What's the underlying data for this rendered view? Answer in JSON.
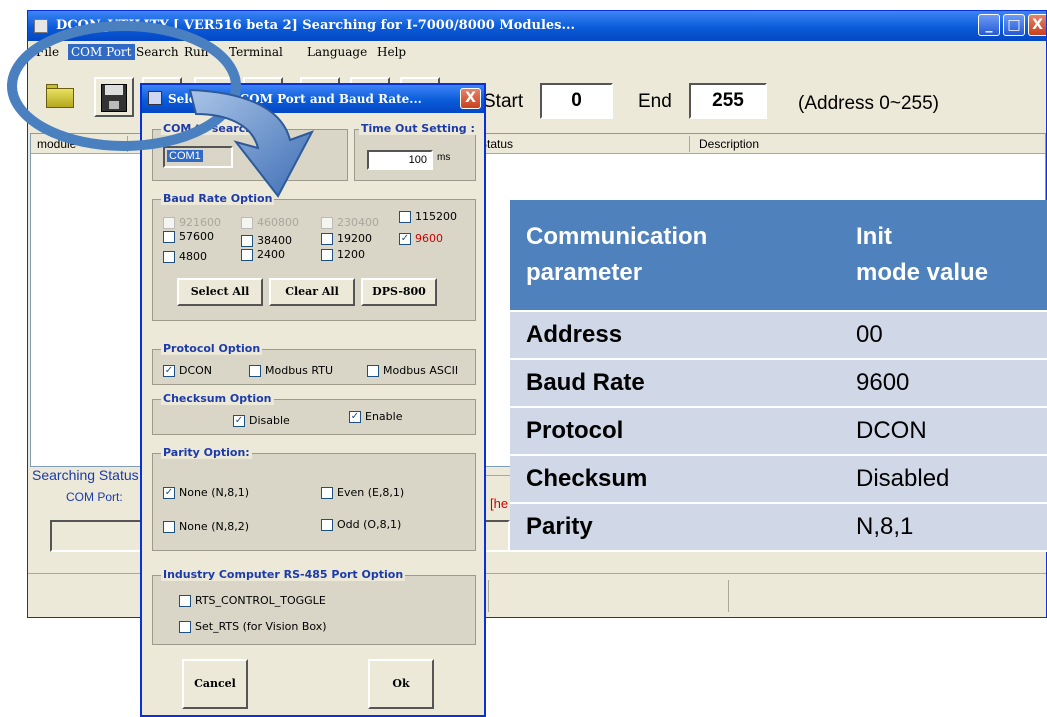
{
  "window": {
    "title": "DCON_UTILITY [ VER516 beta 2] Searching for I-7000/8000 Modules...",
    "controls": {
      "minimize": "_",
      "maximize": "□",
      "close": "X"
    }
  },
  "menu": [
    "File",
    "COM Port",
    "Search",
    "Run",
    "Terminal",
    "Language",
    "Help"
  ],
  "toolbar": {
    "start_label": "Start",
    "start_value": "0",
    "end_label": "End",
    "end_value": "255",
    "address_note": "(Address 0~255)"
  },
  "list": {
    "columns": [
      "module",
      "Status",
      "Description"
    ]
  },
  "search_status": {
    "title": "Searching Status",
    "com_port_label": "COM Port:",
    "fragment": "[he"
  },
  "dialog": {
    "title": "Select the COM Port and Baud Rate...",
    "com_group_title": "COM to search",
    "com_value": "COM1",
    "timeout_group_title": "Time Out Setting :",
    "timeout_value": "100",
    "timeout_unit": "ms",
    "baud_group_title": "Baud Rate Option",
    "baud_rates": [
      {
        "label": "921600",
        "checked": false,
        "disabled": true
      },
      {
        "label": "460800",
        "checked": false,
        "disabled": true
      },
      {
        "label": "230400",
        "checked": false,
        "disabled": true
      },
      {
        "label": "115200",
        "checked": false,
        "disabled": false
      },
      {
        "label": "57600",
        "checked": false,
        "disabled": false
      },
      {
        "label": "38400",
        "checked": false,
        "disabled": false
      },
      {
        "label": "19200",
        "checked": false,
        "disabled": false
      },
      {
        "label": "9600",
        "checked": true,
        "disabled": false
      },
      {
        "label": "4800",
        "checked": false,
        "disabled": false
      },
      {
        "label": "2400",
        "checked": false,
        "disabled": false
      },
      {
        "label": "1200",
        "checked": false,
        "disabled": false
      }
    ],
    "select_all": "Select All",
    "clear_all": "Clear All",
    "dps800": "DPS-800",
    "protocol_group_title": "Protocol Option",
    "protocols": [
      {
        "label": "DCON",
        "checked": true
      },
      {
        "label": "Modbus RTU",
        "checked": false
      },
      {
        "label": "Modbus ASCII",
        "checked": false
      }
    ],
    "checksum_group_title": "Checksum  Option",
    "checksum": [
      {
        "label": "Disable",
        "checked": true
      },
      {
        "label": "Enable",
        "checked": true
      }
    ],
    "parity_group_title": "Parity Option:",
    "parity": [
      {
        "label": "None (N,8,1)",
        "checked": true
      },
      {
        "label": "Even (E,8,1)",
        "checked": false
      },
      {
        "label": "None (N,8,2)",
        "checked": false
      },
      {
        "label": "Odd (O,8,1)",
        "checked": false
      }
    ],
    "rs485_group_title": "Industry Computer RS-485 Port Option",
    "rs485": [
      {
        "label": "RTS_CONTROL_TOGGLE",
        "checked": false
      },
      {
        "label": "Set_RTS (for Vision Box)",
        "checked": false
      }
    ],
    "cancel": "Cancel",
    "ok": "Ok",
    "close": "X"
  },
  "param_table": {
    "header": {
      "col1_line1": "Communication",
      "col1_line2": "parameter",
      "col2_line1": "Init",
      "col2_line2": "mode value"
    },
    "rows": [
      {
        "param": "Address",
        "value": "00"
      },
      {
        "param": "Baud Rate",
        "value": "9600"
      },
      {
        "param": "Protocol",
        "value": "DCON"
      },
      {
        "param": "Checksum",
        "value": "Disabled"
      },
      {
        "param": "Parity",
        "value": "N,8,1"
      }
    ]
  },
  "colors": {
    "title_blue": "#0a5bd8",
    "highlight_oval": "#4a7fc0",
    "table_header": "#4f81bd",
    "table_row": "#d0d8e8",
    "group_title": "#1c3ba8",
    "selected_baud": "#d00000"
  }
}
